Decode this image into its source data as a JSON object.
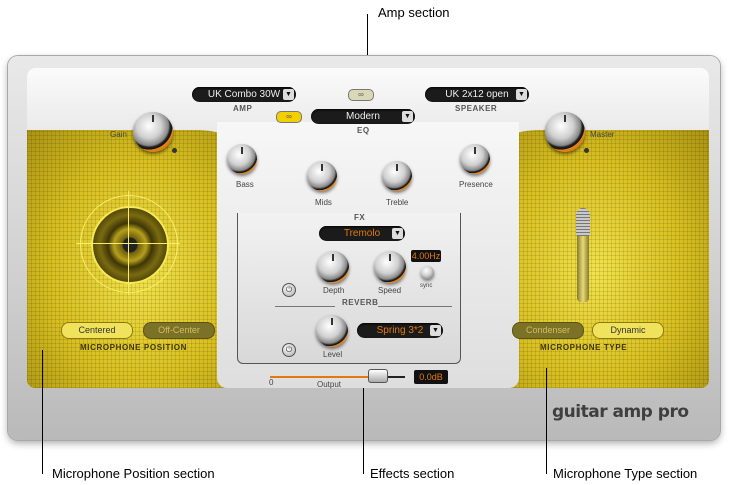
{
  "callouts": {
    "amp": "Amp section",
    "mic_position": "Microphone Position section",
    "effects": "Effects section",
    "mic_type": "Microphone Type section"
  },
  "amp": {
    "amp_model": "UK Combo 30W",
    "amp_label": "AMP",
    "speaker_model": "UK 2x12 open",
    "speaker_label": "SPEAKER",
    "eq_model": "Modern",
    "eq_label": "EQ",
    "knobs": {
      "gain": "Gain",
      "bass": "Bass",
      "mids": "Mids",
      "treble": "Treble",
      "presence": "Presence",
      "master": "Master"
    }
  },
  "fx": {
    "label": "FX",
    "effect": "Tremolo",
    "depth": "Depth",
    "speed": "Speed",
    "speed_value": "4.00Hz",
    "sync": "sync"
  },
  "reverb": {
    "label": "REVERB",
    "type": "Spring 3*2",
    "level": "Level"
  },
  "output": {
    "label": "Output",
    "min": "0",
    "value": "0.0dB"
  },
  "mic_position": {
    "centered": "Centered",
    "off_center": "Off-Center",
    "title": "MICROPHONE POSITION"
  },
  "mic_type": {
    "condenser": "Condenser",
    "dynamic": "Dynamic",
    "title": "MICROPHONE TYPE"
  },
  "brand": "guitar amp pro",
  "colors": {
    "accent": "#e07a10",
    "panel_yellow": "#d9c020"
  }
}
